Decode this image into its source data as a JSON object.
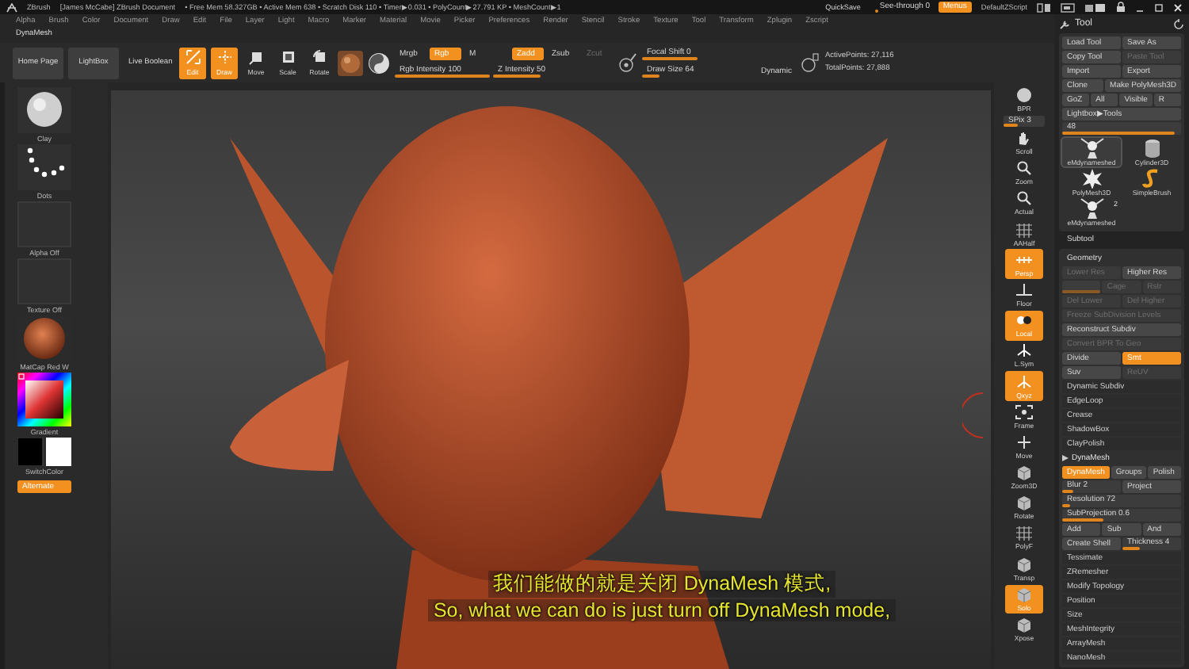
{
  "title_bar": {
    "app": "ZBrush",
    "document": "[James McCabe]  ZBrush Document",
    "status": "• Free Mem 58.327GB • Active Mem 638 • Scratch Disk 110 • Timer▶0.031 • PolyCount▶27.791 KP • MeshCount▶1",
    "quicksave": "QuickSave",
    "see_through": {
      "label": "See-through  0",
      "level": 0.05
    },
    "menus": {
      "label": "Menus",
      "on": true
    },
    "script": "DefaultZScript"
  },
  "menu_bar": [
    "Alpha",
    "Brush",
    "Color",
    "Document",
    "Draw",
    "Edit",
    "File",
    "Layer",
    "Light",
    "Macro",
    "Marker",
    "Material",
    "Movie",
    "Picker",
    "Preferences",
    "Render",
    "Stencil",
    "Stroke",
    "Texture",
    "Tool",
    "Transform",
    "Zplugin",
    "Zscript"
  ],
  "palette": "DynaMesh",
  "toolbar": {
    "buttons": [
      {
        "label": "Home Page",
        "kind": "button"
      },
      {
        "label": "LightBox",
        "kind": "button"
      },
      {
        "label": "Live Boolean",
        "kind": "plain"
      }
    ],
    "modes": [
      {
        "label": "Edit",
        "selected": true
      },
      {
        "label": "Draw",
        "selected": true
      },
      {
        "label": "Move",
        "selected": false
      },
      {
        "label": "Scale",
        "selected": false
      },
      {
        "label": "Rotate",
        "selected": false
      }
    ],
    "color_modes": [
      {
        "label": "Mrgb",
        "on": false,
        "disabled": false
      },
      {
        "label": "Rgb",
        "on": true,
        "disabled": false
      },
      {
        "label": "M",
        "on": false,
        "disabled": false
      }
    ],
    "z_modes": [
      {
        "label": "Zadd",
        "on": true,
        "disabled": false
      },
      {
        "label": "Zsub",
        "on": false,
        "disabled": false
      },
      {
        "label": "Zcut",
        "on": false,
        "disabled": true
      }
    ],
    "intensity_sliders": [
      {
        "label": "Rgb Intensity 100",
        "level": 1
      },
      {
        "label": "Z Intensity 50",
        "level": 0.5
      }
    ],
    "brush_sliders": [
      {
        "label": "Focal Shift 0",
        "level": 0.5
      },
      {
        "label": "Draw Size 64",
        "level": 0.15
      }
    ],
    "dynamic": "Dynamic",
    "active_points": "ActivePoints: 27,116",
    "total_points": "TotalPoints: 27,888"
  },
  "left_panel": {
    "items": [
      {
        "label": "Clay",
        "kind": "brush"
      },
      {
        "label": "Dots",
        "kind": "stroke"
      },
      {
        "label": "Alpha Off",
        "kind": "empty"
      },
      {
        "label": "Texture Off",
        "kind": "empty"
      },
      {
        "label": "MatCap Red W",
        "kind": "material"
      },
      {
        "label": "Gradient",
        "kind": "picker"
      },
      {
        "label": "SwitchColor",
        "kind": "swatches"
      }
    ],
    "alternate": {
      "label": "Alternate",
      "on": true
    }
  },
  "viewport": {
    "subtitles": [
      "我们能做的就是关闭 DynaMesh 模式,",
      "So, what we can do is just turn off DynaMesh mode,"
    ]
  },
  "shelf": [
    {
      "kind": "button",
      "label": "BPR",
      "on": false
    },
    {
      "kind": "slider",
      "label": "SPix 3",
      "level": 0.35
    },
    {
      "kind": "button",
      "label": "Scroll",
      "on": false
    },
    {
      "kind": "button",
      "label": "Zoom",
      "on": false
    },
    {
      "kind": "button",
      "label": "Actual",
      "on": false
    },
    {
      "kind": "button",
      "label": "AAHalf",
      "on": false
    },
    {
      "kind": "button",
      "label": "Persp",
      "on": true
    },
    {
      "kind": "button",
      "label": "Floor",
      "on": false
    },
    {
      "kind": "button",
      "label": "Local",
      "on": true
    },
    {
      "kind": "button",
      "label": "L.Sym",
      "on": false
    },
    {
      "kind": "button",
      "label": "Qxyz",
      "on": true
    },
    {
      "kind": "button",
      "label": "Frame",
      "on": false
    },
    {
      "kind": "button",
      "label": "Move",
      "on": false
    },
    {
      "kind": "button",
      "label": "Zoom3D",
      "on": false
    },
    {
      "kind": "button",
      "label": "Rotate",
      "on": false
    },
    {
      "kind": "button",
      "label": "PolyF",
      "on": false
    },
    {
      "kind": "button",
      "label": "Transp",
      "on": false
    },
    {
      "kind": "button",
      "label": "Solo",
      "on": true
    },
    {
      "kind": "button",
      "label": "Xpose",
      "on": false
    }
  ],
  "tool_panel": {
    "title": "Tool",
    "rows": [
      [
        {
          "kind": "button",
          "label": "Load Tool",
          "on": false,
          "disabled": false
        },
        {
          "kind": "button",
          "label": "Save As",
          "on": false,
          "disabled": false
        }
      ],
      [
        {
          "kind": "button",
          "label": "Copy Tool",
          "on": false,
          "disabled": false
        },
        {
          "kind": "button",
          "label": "Paste Tool",
          "on": false,
          "disabled": true
        }
      ],
      [
        {
          "kind": "button",
          "label": "Import",
          "on": false,
          "disabled": false
        },
        {
          "kind": "button",
          "label": "Export",
          "on": false,
          "disabled": false
        }
      ],
      [
        {
          "kind": "button",
          "label": "Clone",
          "on": false,
          "disabled": false
        },
        {
          "kind": "button",
          "label": "Make PolyMesh3D",
          "on": false,
          "disabled": false
        }
      ],
      [
        {
          "kind": "button",
          "label": "GoZ",
          "on": false,
          "disabled": false
        },
        {
          "kind": "button",
          "label": "All",
          "on": false,
          "disabled": false
        },
        {
          "kind": "button",
          "label": "Visible",
          "on": false,
          "disabled": false
        },
        {
          "kind": "button",
          "label": "R",
          "on": false,
          "disabled": false
        }
      ],
      [
        {
          "kind": "button",
          "label": "Lightbox▶Tools",
          "on": false,
          "disabled": false
        }
      ],
      [
        {
          "kind": "slider",
          "label": "48",
          "level": 0.95,
          "disabled": false
        }
      ]
    ],
    "thumbnails": [
      {
        "label": "eMdynameshed",
        "selected": true
      },
      {
        "label": "Cylinder3D",
        "selected": false
      },
      {
        "label": "PolyMesh3D",
        "selected": false
      },
      {
        "label": "SimpleBrush",
        "selected": false
      },
      {
        "label": "eMdynameshed",
        "selected": false,
        "count": "2"
      }
    ],
    "subtool": "Subtool",
    "geometry": {
      "title": "Geometry",
      "rows": [
        [
          {
            "kind": "button",
            "label": "Lower Res",
            "on": false,
            "disabled": true
          },
          {
            "kind": "button",
            "label": "Higher Res",
            "on": false,
            "disabled": false
          }
        ],
        [
          {
            "kind": "slider",
            "level": 1,
            "disabled": true
          },
          {
            "kind": "button",
            "label": "Cage",
            "on": false,
            "disabled": true
          },
          {
            "kind": "button",
            "label": "Rstr",
            "on": false,
            "disabled": true
          }
        ],
        [
          {
            "kind": "button",
            "label": "Del Lower",
            "on": false,
            "disabled": true
          },
          {
            "kind": "button",
            "label": "Del Higher",
            "on": false,
            "disabled": true
          }
        ],
        [
          {
            "kind": "button",
            "label": "Freeze SubDivision Levels",
            "on": false,
            "disabled": true
          }
        ],
        [
          {
            "kind": "button",
            "label": "Reconstruct Subdiv",
            "on": false,
            "disabled": false
          }
        ],
        [
          {
            "kind": "button",
            "label": "Convert BPR To Geo",
            "on": false,
            "disabled": true
          }
        ],
        [
          {
            "kind": "button",
            "label": "Divide",
            "on": false,
            "disabled": false
          },
          {
            "kind": "button",
            "label": "Smt",
            "on": true,
            "disabled": false
          }
        ],
        [
          {
            "kind": "button",
            "label": "Suv",
            "on": false,
            "disabled": false
          },
          {
            "kind": "button",
            "label": "ReUV",
            "on": false,
            "disabled": true
          }
        ],
        [
          {
            "kind": "item",
            "label": "Dynamic Subdiv"
          }
        ],
        [
          {
            "kind": "item",
            "label": "EdgeLoop"
          }
        ],
        [
          {
            "kind": "item",
            "label": "Crease"
          }
        ],
        [
          {
            "kind": "item",
            "label": "ShadowBox"
          }
        ],
        [
          {
            "kind": "item",
            "label": "ClayPolish"
          }
        ],
        [
          {
            "kind": "section",
            "label": "DynaMesh"
          }
        ],
        [
          {
            "kind": "button",
            "label": "DynaMesh",
            "on": true,
            "disabled": false
          },
          {
            "kind": "button",
            "label": "Groups",
            "on": false,
            "disabled": false
          },
          {
            "kind": "button",
            "label": "Polish",
            "on": false,
            "disabled": false
          }
        ],
        [
          {
            "kind": "slider",
            "label": "Blur 2",
            "level": 0.2,
            "disabled": false
          },
          {
            "kind": "button",
            "label": "Project",
            "on": false,
            "disabled": false
          }
        ],
        [
          {
            "kind": "slider",
            "label": "Resolution 72",
            "level": 0.06,
            "disabled": false
          }
        ],
        [
          {
            "kind": "slider",
            "label": "SubProjection 0.6",
            "level": 0.35,
            "disabled": false
          }
        ],
        [
          {
            "kind": "button",
            "label": "Add",
            "on": false,
            "disabled": false
          },
          {
            "kind": "button",
            "label": "Sub",
            "on": false,
            "disabled": false
          },
          {
            "kind": "button",
            "label": "And",
            "on": false,
            "disabled": false
          }
        ],
        [
          {
            "kind": "button",
            "label": "Create Shell",
            "on": false,
            "disabled": false
          },
          {
            "kind": "slider",
            "label": "Thickness 4",
            "level": 0.3,
            "disabled": false
          }
        ],
        [
          {
            "kind": "item",
            "label": "Tessimate"
          }
        ],
        [
          {
            "kind": "item",
            "label": "ZRemesher"
          }
        ],
        [
          {
            "kind": "item",
            "label": "Modify Topology"
          }
        ],
        [
          {
            "kind": "item",
            "label": "Position"
          }
        ],
        [
          {
            "kind": "item",
            "label": "Size"
          }
        ],
        [
          {
            "kind": "item",
            "label": "MeshIntegrity"
          }
        ],
        [
          {
            "kind": "item",
            "label": "ArrayMesh"
          }
        ],
        [
          {
            "kind": "item",
            "label": "NanoMesh"
          }
        ]
      ]
    }
  }
}
